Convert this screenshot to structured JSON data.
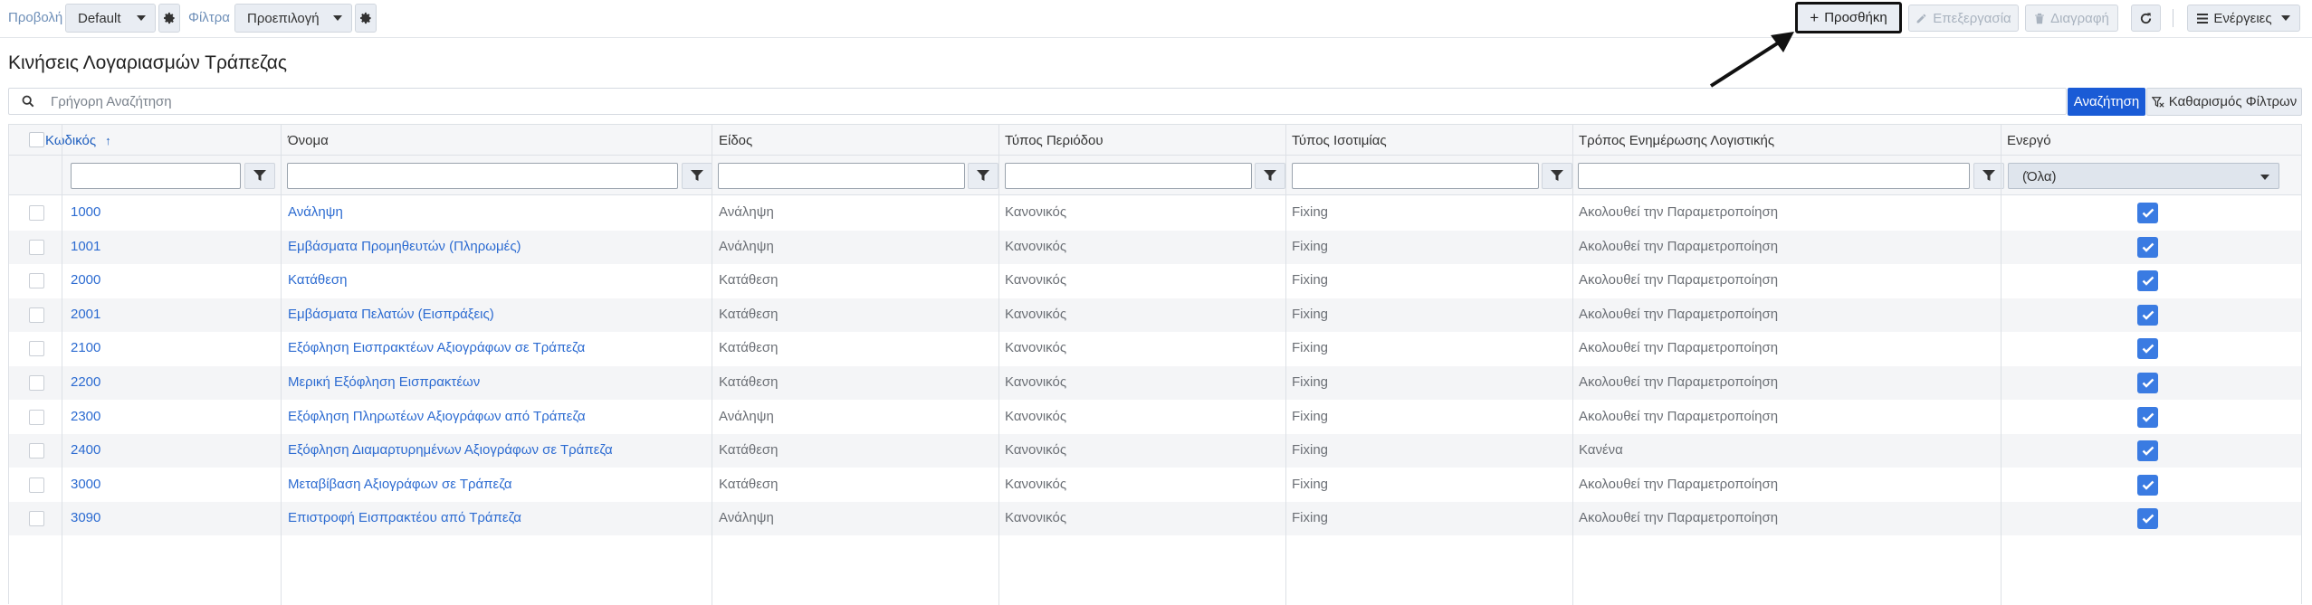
{
  "toolbar": {
    "view_label": "Προβολή",
    "view_value": "Default",
    "filters_label": "Φίλτρα",
    "filters_value": "Προεπιλογή",
    "add_label": "Προσθήκη",
    "edit_label": "Επεξεργασία",
    "delete_label": "Διαγραφή",
    "actions_label": "Ενέργειες"
  },
  "page": {
    "title": "Κινήσεις Λογαριασμών Τράπεζας"
  },
  "search": {
    "placeholder": "Γρήγορη Αναζήτηση",
    "search_button": "Αναζήτηση",
    "clear_button": "Καθαρισμός Φίλτρων"
  },
  "table": {
    "columns": {
      "code": "Κωδικός",
      "name": "Όνομα",
      "kind": "Είδος",
      "period_type": "Τύπος Περιόδου",
      "parity_type": "Τύπος Ισοτιμίας",
      "accounting_update": "Τρόπος Ενημέρωσης Λογιστικής",
      "active": "Ενεργό"
    },
    "active_filter_value": "(Όλα)",
    "rows": [
      {
        "code": "1000",
        "name": "Ανάληψη",
        "kind": "Ανάληψη",
        "period": "Κανονικός",
        "parity": "Fixing",
        "update": "Ακολουθεί την Παραμετροποίηση",
        "active": true
      },
      {
        "code": "1001",
        "name": "Εμβάσματα Προμηθευτών (Πληρωμές)",
        "kind": "Ανάληψη",
        "period": "Κανονικός",
        "parity": "Fixing",
        "update": "Ακολουθεί την Παραμετροποίηση",
        "active": true
      },
      {
        "code": "2000",
        "name": "Κατάθεση",
        "kind": "Κατάθεση",
        "period": "Κανονικός",
        "parity": "Fixing",
        "update": "Ακολουθεί την Παραμετροποίηση",
        "active": true
      },
      {
        "code": "2001",
        "name": "Εμβάσματα Πελατών (Εισπράξεις)",
        "kind": "Κατάθεση",
        "period": "Κανονικός",
        "parity": "Fixing",
        "update": "Ακολουθεί την Παραμετροποίηση",
        "active": true
      },
      {
        "code": "2100",
        "name": "Εξόφληση Εισπρακτέων Αξιογράφων σε Τράπεζα",
        "kind": "Κατάθεση",
        "period": "Κανονικός",
        "parity": "Fixing",
        "update": "Ακολουθεί την Παραμετροποίηση",
        "active": true
      },
      {
        "code": "2200",
        "name": "Μερική Εξόφληση Εισπρακτέων",
        "kind": "Κατάθεση",
        "period": "Κανονικός",
        "parity": "Fixing",
        "update": "Ακολουθεί την Παραμετροποίηση",
        "active": true
      },
      {
        "code": "2300",
        "name": "Εξόφληση Πληρωτέων Αξιογράφων από Τράπεζα",
        "kind": "Ανάληψη",
        "period": "Κανονικός",
        "parity": "Fixing",
        "update": "Ακολουθεί την Παραμετροποίηση",
        "active": true
      },
      {
        "code": "2400",
        "name": "Εξόφληση Διαμαρτυρημένων Αξιογράφων σε Τράπεζα",
        "kind": "Κατάθεση",
        "period": "Κανονικός",
        "parity": "Fixing",
        "update": "Κανένα",
        "active": true
      },
      {
        "code": "3000",
        "name": "Μεταβίβαση Αξιογράφων σε Τράπεζα",
        "kind": "Κατάθεση",
        "period": "Κανονικός",
        "parity": "Fixing",
        "update": "Ακολουθεί την Παραμετροποίηση",
        "active": true
      },
      {
        "code": "3090",
        "name": "Επιστροφή Εισπρακτέου από Τράπεζα",
        "kind": "Ανάληψη",
        "period": "Κανονικός",
        "parity": "Fixing",
        "update": "Ακολουθεί την Παραμετροποίηση",
        "active": true
      }
    ]
  },
  "colors": {
    "link": "#2c6bd1",
    "primary_button": "#1a5bd6",
    "checkbox_active": "#3a7be2"
  }
}
